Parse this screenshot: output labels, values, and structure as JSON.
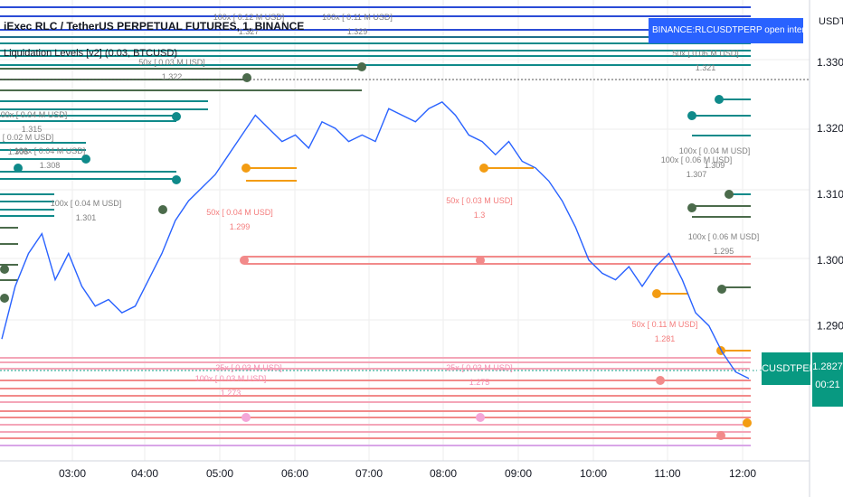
{
  "header": {
    "symbol_title": "iExec RLC / TetherUS PERPETUAL FUTURES, 1, BINANCE",
    "indicator_title": "Liquidation Levels [v2] (0.03, BTCUSD)",
    "oi_label": "BINANCE:RLCUSDTPERP open interest data: RLCUSDTPERP_OI",
    "currency": "USDT"
  },
  "badges": {
    "symbol": "RLCUSDTPERP",
    "price": "1.2827",
    "countdown": "00:21"
  },
  "chart_data": {
    "type": "line",
    "x_ticks": [
      "03:00",
      "04:00",
      "05:00",
      "06:00",
      "07:00",
      "08:00",
      "09:00",
      "10:00",
      "11:00",
      "12:00"
    ],
    "y_ticks": [
      "1.3300",
      "1.3200",
      "1.3100",
      "1.3000",
      "1.2900",
      "1.2827"
    ],
    "ylim": [
      1.2695,
      1.3395
    ],
    "series": [
      {
        "values": [
          1.288,
          1.296,
          1.301,
          1.304,
          1.297,
          1.301,
          1.296,
          1.293,
          1.294,
          1.292,
          1.293,
          1.297,
          1.301,
          1.306,
          1.309,
          1.311,
          1.313,
          1.316,
          1.319,
          1.322,
          1.32,
          1.318,
          1.319,
          1.317,
          1.321,
          1.32,
          1.318,
          1.319,
          1.318,
          1.323,
          1.322,
          1.321,
          1.323,
          1.324,
          1.322,
          1.319,
          1.318,
          1.316,
          1.318,
          1.315,
          1.314,
          1.312,
          1.309,
          1.305,
          1.3,
          1.298,
          1.297,
          1.299,
          1.296,
          1.299,
          1.301,
          1.297,
          1.292,
          1.29,
          1.286,
          1.283,
          1.282
        ]
      }
    ],
    "liquidation_labels": [
      {
        "text": "100x [ 0.11 M USD]",
        "price": "1.329",
        "color": "#7f7f7f"
      },
      {
        "text": "100x [ 0.12 M USD]",
        "price": "1.327",
        "color": "#7f7f7f"
      },
      {
        "text": "50x [ 0.03 M USD]",
        "price": "1.322",
        "color": "#7f7f7f"
      },
      {
        "text": "50x [ 0.06 M USD]",
        "price": "1.321",
        "color": "#7f7f7f"
      },
      {
        "text": "100x [ 0.04 M USD]",
        "price": "1.315",
        "color": "#7f7f7f"
      },
      {
        "text": "100x [ 0.04 M USD]",
        "price": "1.308",
        "color": "#7f7f7f"
      },
      {
        "text": "100x [ 0.02 M USD]",
        "price": "1.308",
        "color": "#7f7f7f"
      },
      {
        "text": "100x [ 0.04 M USD]",
        "price": "1.301",
        "color": "#7f7f7f"
      },
      {
        "text": "100x [ 0.04 M USD]",
        "price": "1.309",
        "color": "#7f7f7f"
      },
      {
        "text": "100x [ 0.06 M USD]",
        "price": "1.307",
        "color": "#7f7f7f"
      },
      {
        "text": "100x [ 0.06 M USD]",
        "price": "1.295",
        "color": "#7f7f7f"
      },
      {
        "text": "50x [ 0.03 M USD]",
        "price": "1.3",
        "color": "#f47c7c"
      },
      {
        "text": "50x [ 0.04 M USD]",
        "price": "1.299",
        "color": "#f47c7c"
      },
      {
        "text": "50x [ 0.11 M USD]",
        "price": "1.281",
        "color": "#f47c7c"
      },
      {
        "text": "25x [ 0.03 M USD]",
        "price": "",
        "color": "#f48fb1"
      },
      {
        "text": "25x [ 0.03 M USD]",
        "price": "1.275",
        "color": "#f48fb1"
      },
      {
        "text": "100x [ 0.03 M USD]",
        "price": "1.273",
        "color": "#f48fb1"
      }
    ]
  }
}
